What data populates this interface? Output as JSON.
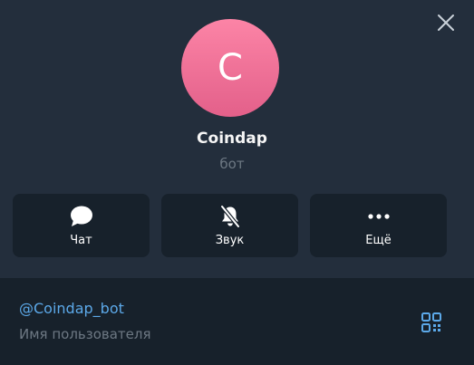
{
  "profile": {
    "avatar_letter": "C",
    "name": "Coindap",
    "status": "бот"
  },
  "actions": [
    {
      "label": "Чат",
      "icon": "chat-bubble-icon"
    },
    {
      "label": "Звук",
      "icon": "bell-muted-icon"
    },
    {
      "label": "Ещё",
      "icon": "more-dots-icon"
    }
  ],
  "info": {
    "username": "@Coindap_bot",
    "username_caption": "Имя пользователя",
    "qr_icon": "qr-code-icon"
  },
  "colors": {
    "header_bg": "#232e3c",
    "panel_bg": "#17212b",
    "avatar_top": "#fc84a6",
    "avatar_bottom": "#e3608a",
    "link": "#5ca9e9",
    "muted_text": "#6d7883"
  }
}
